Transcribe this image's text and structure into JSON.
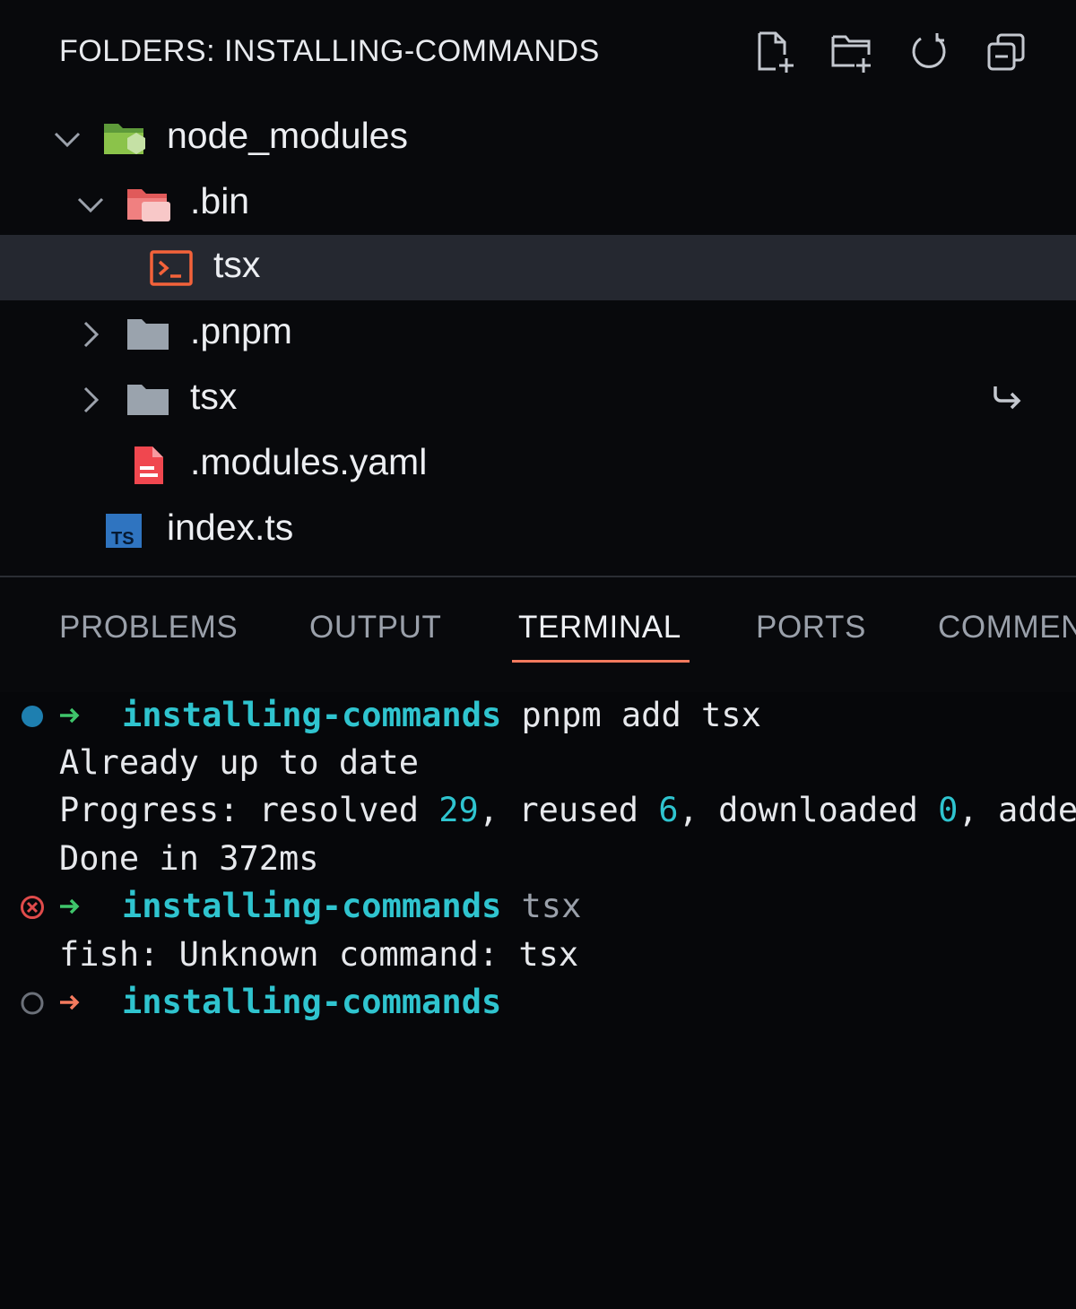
{
  "explorer": {
    "title": "FOLDERS: INSTALLING-COMMANDS",
    "actions": [
      {
        "name": "new-file-icon"
      },
      {
        "name": "new-folder-icon"
      },
      {
        "name": "refresh-icon"
      },
      {
        "name": "collapse-all-icon"
      }
    ],
    "tree": [
      {
        "label": "node_modules",
        "type": "folder-open",
        "icon": "node-folder-icon",
        "expanded": true
      },
      {
        "label": ".bin",
        "type": "folder-open",
        "icon": "bin-folder-icon",
        "expanded": true
      },
      {
        "label": "tsx",
        "type": "file",
        "icon": "terminal-file-icon",
        "selected": true
      },
      {
        "label": ".pnpm",
        "type": "folder",
        "icon": "folder-icon",
        "expanded": false
      },
      {
        "label": "tsx",
        "type": "folder",
        "icon": "folder-icon",
        "expanded": false,
        "symlink": true
      },
      {
        "label": ".modules.yaml",
        "type": "file",
        "icon": "yaml-file-icon"
      },
      {
        "label": "index.ts",
        "type": "file",
        "icon": "typescript-file-icon"
      }
    ]
  },
  "panel": {
    "tabs": [
      {
        "label": "PROBLEMS",
        "active": false
      },
      {
        "label": "OUTPUT",
        "active": false
      },
      {
        "label": "TERMINAL",
        "active": true
      },
      {
        "label": "PORTS",
        "active": false
      },
      {
        "label": "COMMENTS",
        "active": false
      }
    ],
    "terminal": {
      "cwd": "installing-commands",
      "line1_cmd": "pnpm add tsx",
      "line2": "Already up to date",
      "progress": {
        "prefix": "Progress: resolved ",
        "resolved": "29",
        "sep1": ", reused ",
        "reused": "6",
        "sep2": ", downloaded ",
        "downloaded": "0",
        "sep3": ", added"
      },
      "line4": "Done in 372ms",
      "line5_cmd": "tsx",
      "line6": "fish: Unknown command: tsx"
    }
  },
  "colors": {
    "accent": "#f47a5e",
    "prompt_cwd": "#2fc4cf",
    "arrow_ok": "#3fc56b",
    "arrow_err": "#f47a5e",
    "marker_info": "#1e7fb0",
    "marker_error": "#e04b4b",
    "marker_idle": "#6b7079"
  }
}
